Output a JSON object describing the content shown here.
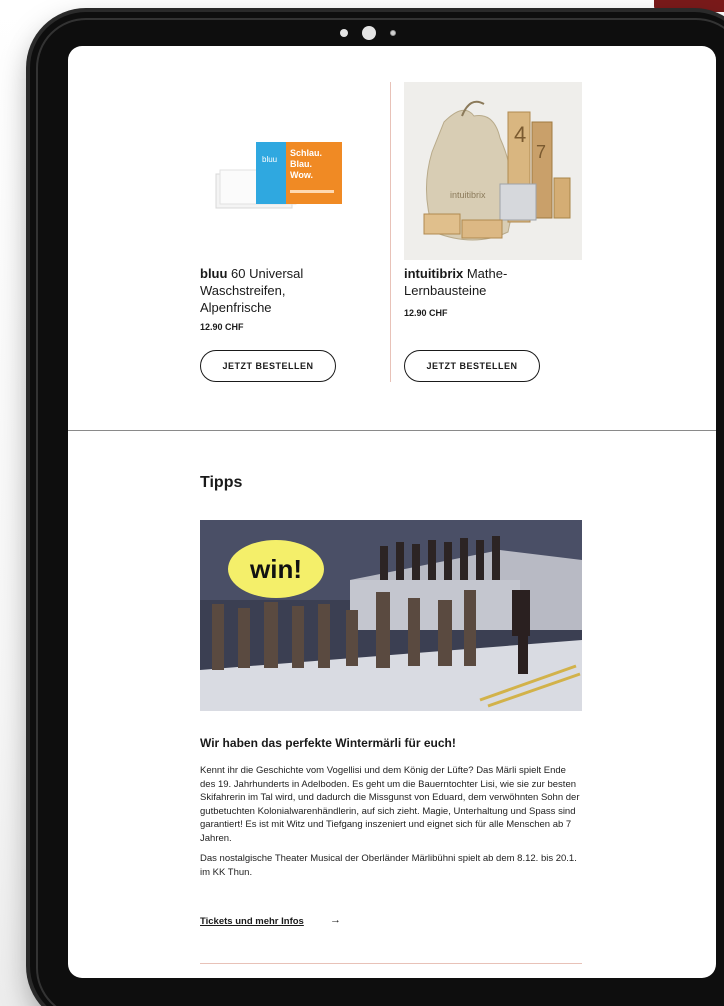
{
  "products": [
    {
      "brand": "bluu",
      "name": " 60 Universal Waschstreifen, Alpenfrische",
      "price": "12.90 CHF",
      "button_label": "JETZT BESTELLEN",
      "box_text": "Schlau. Blau. Wow.",
      "box_brand": "bluu"
    },
    {
      "brand": "intuitibrix",
      "name": " Mathe-Lernbausteine",
      "price": "12.90 CHF",
      "button_label": "JETZT BESTELLEN",
      "bag_text": "intuitibrix"
    }
  ],
  "tips": {
    "section_title": "Tipps",
    "badge": "win!",
    "article_title": "Wir haben das perfekte Wintermärli für euch!",
    "paragraph_1": "Kennt ihr die Geschichte vom Vogellisi und dem König der Lüfte? Das Märli spielt Ende des 19. Jahrhunderts in Adelboden. Es geht um die Bauerntochter Lisi, wie sie zur besten Skifahrerin im Tal wird, und dadurch die Missgunst von Eduard, dem verwöhnten Sohn der gutbetuchten Kolonialwarenhändlerin, auf sich zieht. Magie, Unterhaltung und Spass sind garantiert! Es ist mit Witz und Tiefgang inszeniert und eignet sich für alle Menschen ab 7 Jahren.",
    "paragraph_2": "Das nostalgische Theater Musical der Oberländer Märlibühni spielt ab dem 8.12. bis 20.1. im KK Thun.",
    "link_label": "Tickets und mehr Infos",
    "link_arrow": "→"
  },
  "colors": {
    "accent_divider": "#e8c2b8",
    "badge": "#f4ef6a",
    "bluu_blue": "#2fa8e0",
    "bluu_orange": "#f08a24"
  }
}
